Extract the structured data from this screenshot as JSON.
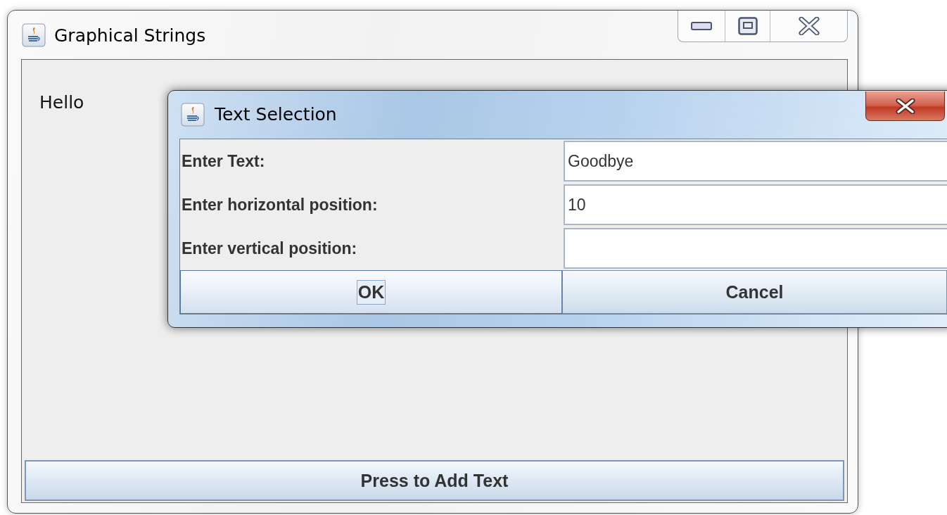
{
  "main_window": {
    "title": "Graphical Strings",
    "canvas_text": "Hello",
    "button": "Press to Add Text"
  },
  "dialog": {
    "title": "Text Selection",
    "fields": [
      {
        "label": "Enter Text:",
        "value": "Goodbye"
      },
      {
        "label": "Enter horizontal position:",
        "value": "10"
      },
      {
        "label": "Enter vertical position:"
      }
    ],
    "buttons": [
      {
        "label": "OK",
        "focused": true
      },
      {
        "label": "Cancel",
        "focused": false
      }
    ]
  }
}
